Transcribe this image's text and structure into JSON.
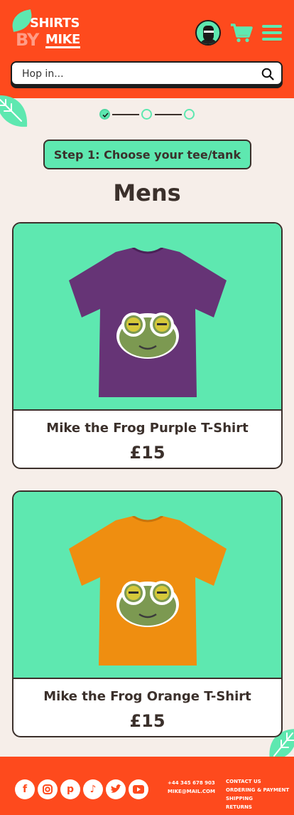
{
  "header": {
    "logo": {
      "line1": "SHIRTS",
      "line2": "BY",
      "line3": "MIKE"
    },
    "avatar_icon": "bearded-man-avatar",
    "cart_icon": "shopping-cart-icon",
    "menu_icon": "hamburger-menu-icon"
  },
  "search": {
    "placeholder": "Hop in..."
  },
  "stepper": {
    "current_step": 1,
    "total_steps": 3
  },
  "step_label": "Step 1: Choose your tee/tank",
  "section_title": "Mens",
  "products": [
    {
      "name": "Mike the Frog Purple T-Shirt",
      "price": "£15",
      "shirt_color": "#663476"
    },
    {
      "name": "Mike the Frog Orange T-Shirt",
      "price": "£15",
      "shirt_color": "#ef8e10"
    }
  ],
  "footer": {
    "social_icons": [
      "facebook-icon",
      "instagram-icon",
      "pinterest-icon",
      "tiktok-icon",
      "twitter-icon",
      "youtube-icon"
    ],
    "phone": "+44 345 678 903",
    "email": "MIKE@MAIL.COM",
    "links": [
      "CONTACT US",
      "ORDERING & PAYMENT",
      "SHIPPING",
      "RETURNS"
    ]
  },
  "colors": {
    "brand_orange": "#fe4a1d",
    "mint": "#5ee8b0",
    "cream": "#f6eee9",
    "dark": "#3b302b"
  }
}
